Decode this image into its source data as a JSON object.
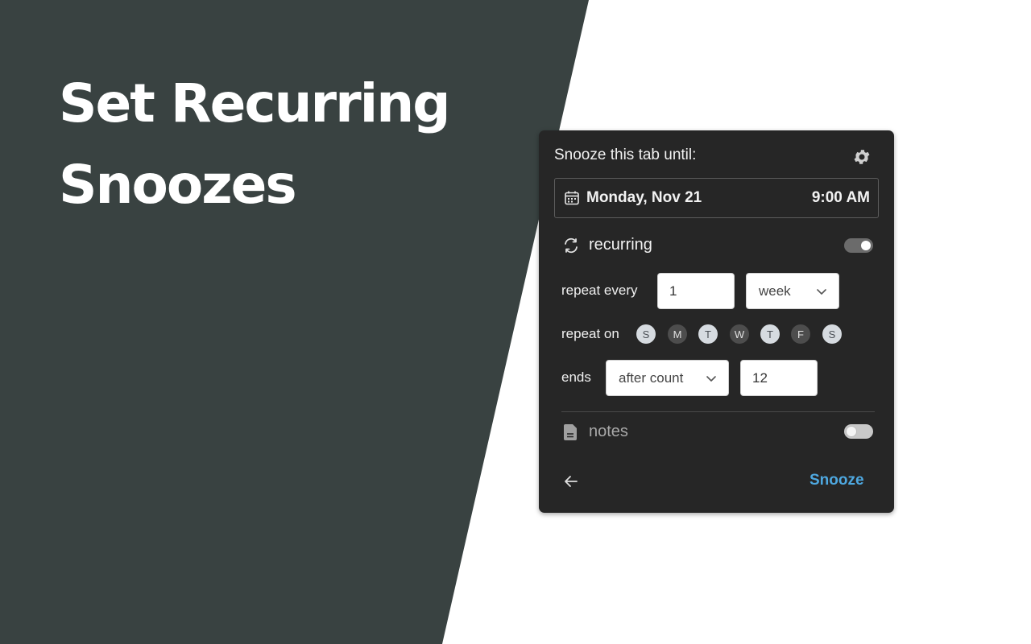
{
  "hero": {
    "line1": "Set Recurring",
    "line2": "Snoozes"
  },
  "popup": {
    "title": "Snooze this tab until:",
    "settings_icon": "gear-icon",
    "date": "Monday, Nov 21",
    "time": "9:00 AM",
    "recurring": {
      "label": "recurring",
      "enabled": true,
      "repeat_every_label": "repeat every",
      "repeat_every_value": "1",
      "repeat_unit": "week",
      "repeat_on_label": "repeat on",
      "days": [
        {
          "letter": "S",
          "selected": true
        },
        {
          "letter": "M",
          "selected": false
        },
        {
          "letter": "T",
          "selected": true
        },
        {
          "letter": "W",
          "selected": false
        },
        {
          "letter": "T",
          "selected": true
        },
        {
          "letter": "F",
          "selected": false
        },
        {
          "letter": "S",
          "selected": true
        }
      ],
      "ends_label": "ends",
      "ends_mode": "after count",
      "ends_count": "12"
    },
    "notes": {
      "label": "notes",
      "enabled": false
    },
    "snooze_label": "Snooze"
  },
  "colors": {
    "dark_panel": "#394241",
    "popup_bg": "#262626",
    "accent": "#4ea8e0"
  }
}
